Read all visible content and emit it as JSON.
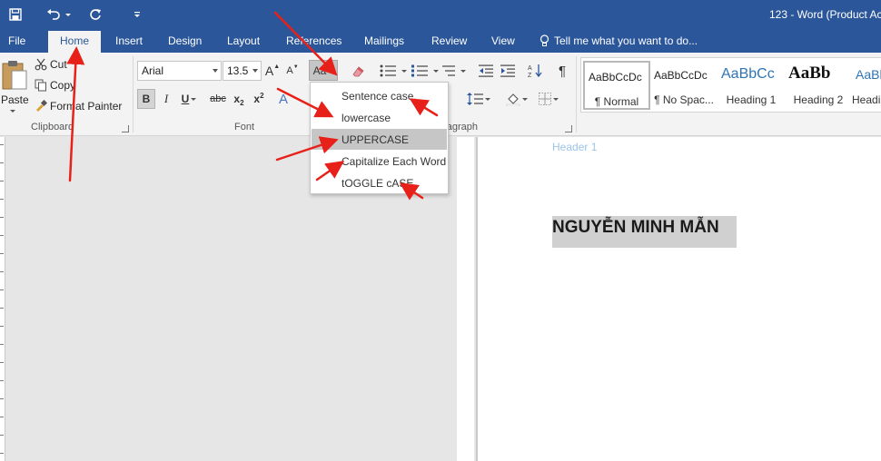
{
  "titlebar": {
    "title": "123 - Word (Product Ac"
  },
  "tabs": [
    {
      "label": "File"
    },
    {
      "label": "Home"
    },
    {
      "label": "Insert"
    },
    {
      "label": "Design"
    },
    {
      "label": "Layout"
    },
    {
      "label": "References"
    },
    {
      "label": "Mailings"
    },
    {
      "label": "Review"
    },
    {
      "label": "View"
    }
  ],
  "tellme": {
    "label": "Tell me what you want to do..."
  },
  "clipboard": {
    "paste": "Paste",
    "cut": "Cut",
    "copy": "Copy",
    "format_painter": "Format Painter",
    "group": "Clipboard"
  },
  "font": {
    "family": "Arial",
    "size": "13.5",
    "grow": "A",
    "shrink": "A",
    "change_case": "Aa",
    "bold": "B",
    "italic": "I",
    "underline": "U",
    "strikethrough": "abc",
    "subscript": "x",
    "superscript": "x",
    "sub_mark": "2",
    "sup_mark": "2",
    "effects": "A",
    "group": "Font"
  },
  "paragraph": {
    "group": "aragraph"
  },
  "styles": [
    {
      "sample": "AaBbCcDc",
      "name": "¶ Normal"
    },
    {
      "sample": "AaBbCcDc",
      "name": "¶ No Spac..."
    },
    {
      "sample": "AaBbCc",
      "name": "Heading 1"
    },
    {
      "sample": "AaBb",
      "name": "Heading 2"
    },
    {
      "sample": "AaBb",
      "name": "Headi"
    }
  ],
  "menu": {
    "items": [
      {
        "label": "Sentence case."
      },
      {
        "label": "lowercase"
      },
      {
        "label": "UPPERCASE"
      },
      {
        "label": "Capitalize Each Word"
      },
      {
        "label": "tOGGLE cASE"
      }
    ]
  },
  "document": {
    "header": "Header 1",
    "heading": "NGUYỄN MINH MẪN"
  },
  "colors": {
    "word_blue": "#2b579a",
    "ribbon_bg": "#f3f3f3",
    "arrow_red": "#e8201a",
    "header_text": "#9dc3e6",
    "menu_highlight": "#c6c6c6"
  }
}
